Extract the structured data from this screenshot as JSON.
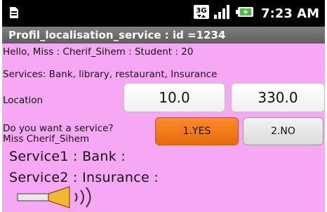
{
  "status_bar": {
    "time": "7:23 AM",
    "network_badge": "3G",
    "icons": [
      "sim-card-icon",
      "3g-icon",
      "signal-icon",
      "battery-icon"
    ]
  },
  "title_bar": {
    "title": "Profil_localisation_service : id =1234"
  },
  "content": {
    "greeting": "Hello,  Miss  : Cherif_Sihem  : Student  : 20",
    "services": "Services: Bank, library, restaurant, Insurance",
    "location_label": "Location",
    "location_x": "10.0",
    "location_y": "330.0",
    "question_line1": "Do you want a service?",
    "question_line2": "Miss Cherif_Sihem",
    "yes_label": "1.YES",
    "no_label": "2.NO",
    "service1": "Service1  : Bank  :",
    "service2": "Service2  : Insurance  :",
    "speaker_icon": "speaker-sound-icon"
  },
  "colors": {
    "background": "#f7a8f4",
    "yes_button": "#f47a1a",
    "title_bar": "#6b6b6b"
  }
}
